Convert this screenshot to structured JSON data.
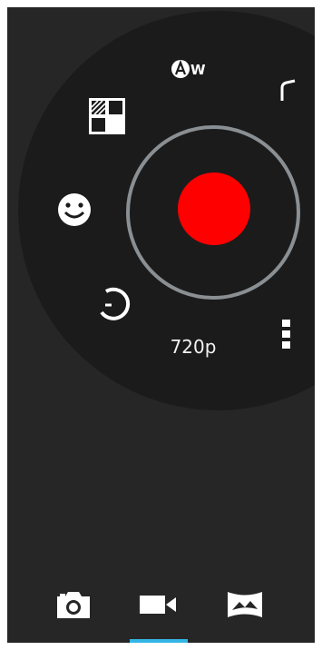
{
  "dial": {
    "auto_white_balance_label": "W",
    "resolution": "720p"
  },
  "icons": [
    "white-balance-icon",
    "corner-icon",
    "exposure-icon",
    "face-detection-icon",
    "timer-icon",
    "overflow-menu-icon",
    "record-button"
  ],
  "tabs": [
    {
      "name": "photo-camera-tab"
    },
    {
      "name": "video-camera-tab",
      "active": true
    },
    {
      "name": "panorama-tab"
    }
  ],
  "colors": {
    "record": "#ff0000",
    "ring": "#8a8f93",
    "active_tab": "#33b5e5",
    "background": "#262626"
  }
}
